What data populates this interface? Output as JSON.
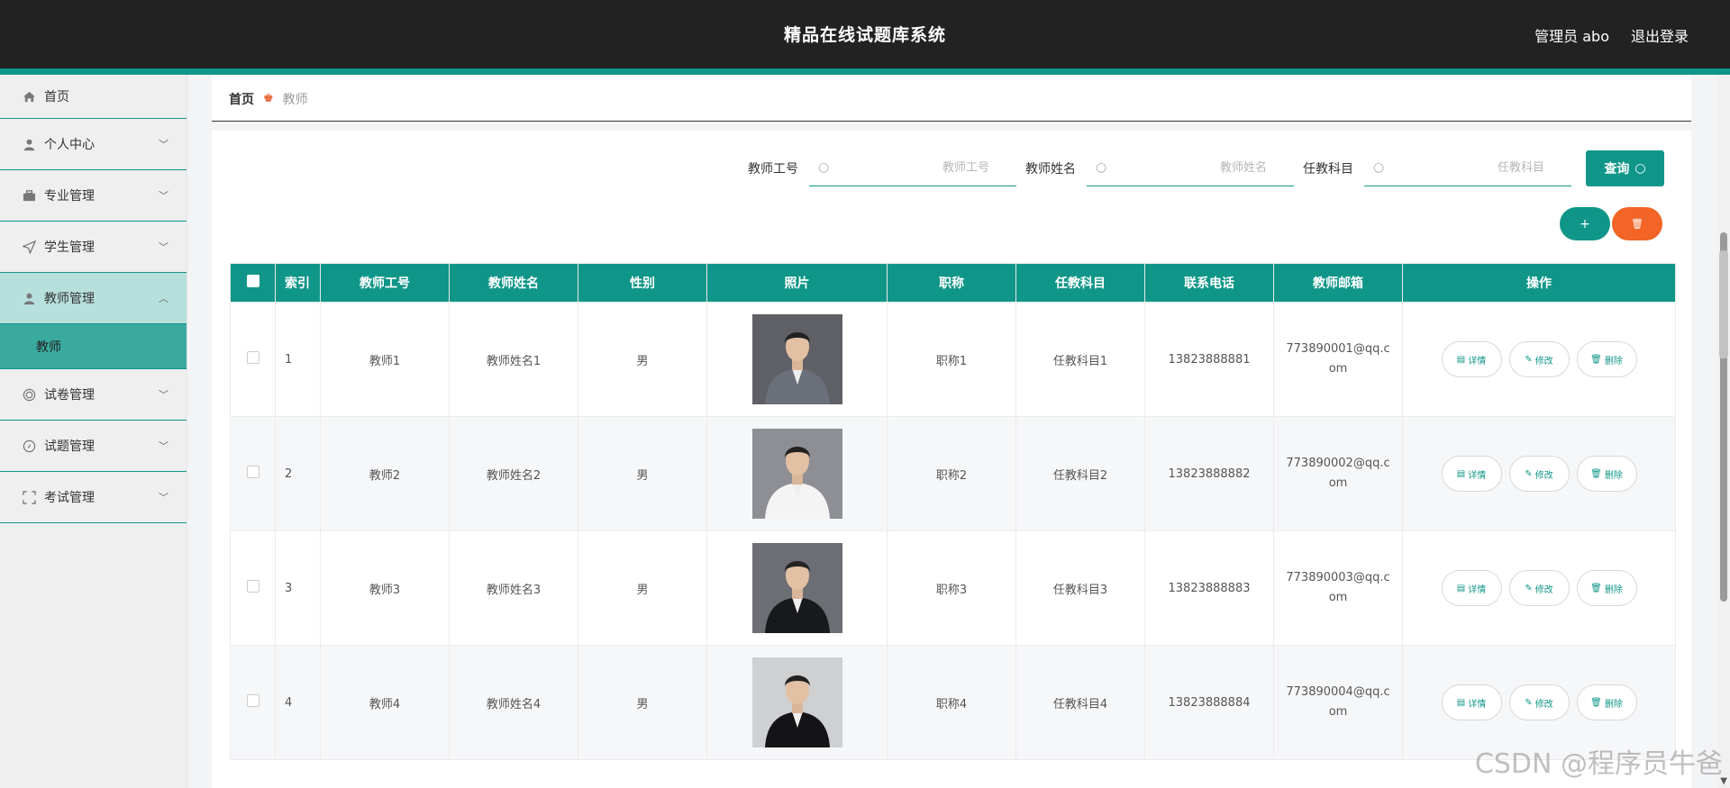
{
  "header": {
    "title": "精品在线试题库系统",
    "user_label": "管理员 abo",
    "logout_label": "退出登录"
  },
  "sidebar": {
    "items": [
      {
        "label": "首页",
        "icon": "home-icon"
      },
      {
        "label": "个人中心",
        "icon": "user-icon"
      },
      {
        "label": "专业管理",
        "icon": "briefcase-icon"
      },
      {
        "label": "学生管理",
        "icon": "send-icon"
      },
      {
        "label": "教师管理",
        "icon": "user-icon"
      },
      {
        "label": "试卷管理",
        "icon": "target-icon"
      },
      {
        "label": "试题管理",
        "icon": "compass-icon"
      },
      {
        "label": "考试管理",
        "icon": "scan-icon"
      }
    ],
    "sub_item": "教师"
  },
  "breadcrumb": {
    "home": "首页",
    "current": "教师"
  },
  "search": {
    "fields": [
      {
        "label": "教师工号",
        "placeholder": "教师工号"
      },
      {
        "label": "教师姓名",
        "placeholder": "教师姓名"
      },
      {
        "label": "任教科目",
        "placeholder": "任教科目"
      }
    ],
    "button_label": "查询"
  },
  "actions": {
    "add_label": "+",
    "delete_label": "🗑"
  },
  "table": {
    "headers": [
      "索引",
      "教师工号",
      "教师姓名",
      "性别",
      "照片",
      "职称",
      "任教科目",
      "联系电话",
      "教师邮箱",
      "操作"
    ],
    "op_labels": {
      "detail": "详情",
      "edit": "修改",
      "delete": "删除"
    },
    "rows": [
      {
        "index": "1",
        "id": "教师1",
        "name": "教师姓名1",
        "gender": "男",
        "title": "职称1",
        "subject": "任教科目1",
        "phone": "13823888881",
        "email": "773890001@qq.com"
      },
      {
        "index": "2",
        "id": "教师2",
        "name": "教师姓名2",
        "gender": "男",
        "title": "职称2",
        "subject": "任教科目2",
        "phone": "13823888882",
        "email": "773890002@qq.com"
      },
      {
        "index": "3",
        "id": "教师3",
        "name": "教师姓名3",
        "gender": "男",
        "title": "职称3",
        "subject": "任教科目3",
        "phone": "13823888883",
        "email": "773890003@qq.com"
      },
      {
        "index": "4",
        "id": "教师4",
        "name": "教师姓名4",
        "gender": "男",
        "title": "职称4",
        "subject": "任教科目4",
        "phone": "13823888884",
        "email": "773890004@qq.com"
      }
    ]
  },
  "watermark": "CSDN @程序员牛爸",
  "colors": {
    "accent": "#109688",
    "danger": "#f26526",
    "header_bg": "#222222"
  }
}
